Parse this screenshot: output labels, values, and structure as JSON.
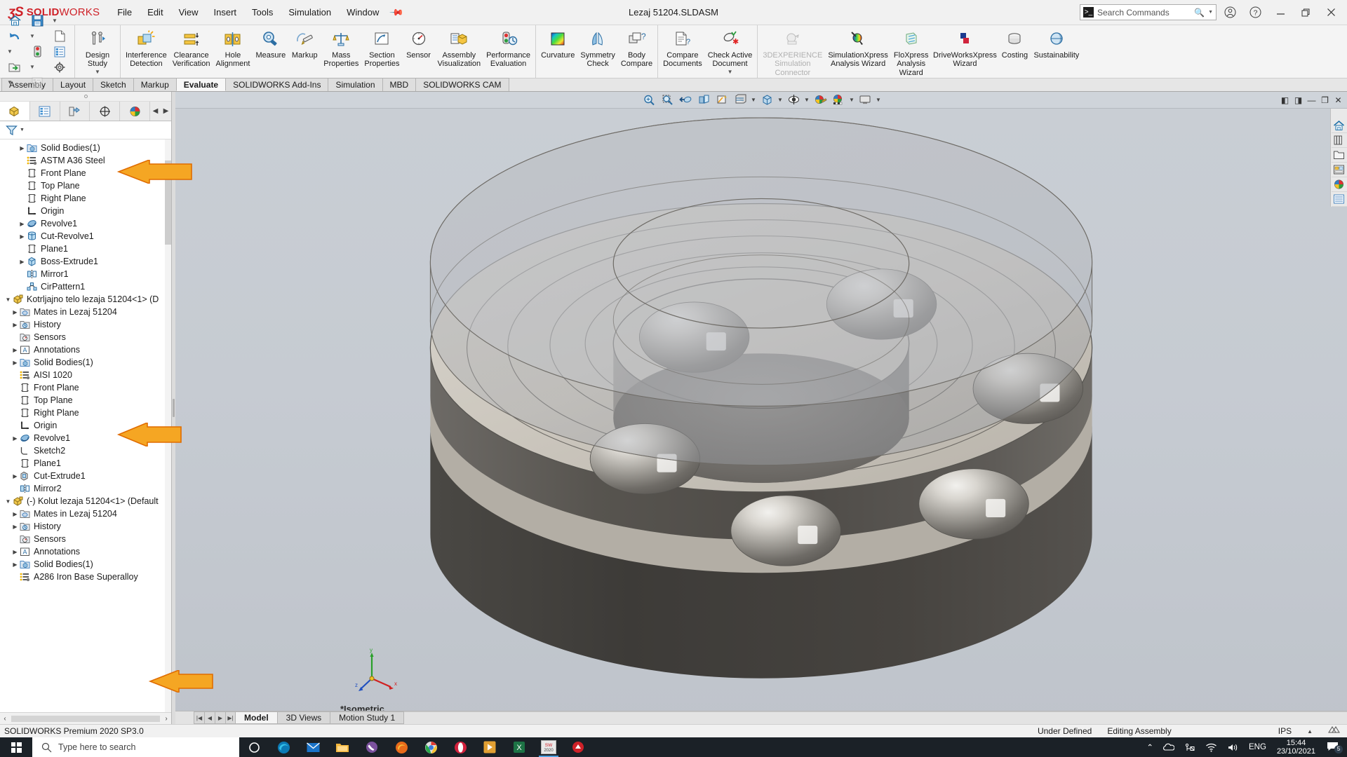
{
  "titlebar": {
    "brand_ds": "ʒS",
    "brand_solid": "SOLID",
    "brand_works": "WORKS",
    "menus": [
      "File",
      "Edit",
      "View",
      "Insert",
      "Tools",
      "Simulation",
      "Window"
    ],
    "document_title": "Lezaj 51204.SLDASM",
    "search_placeholder": "Search Commands",
    "account_icon": "user-icon",
    "help_icon": "help-icon",
    "minimize_icon": "minimize-icon",
    "restore_icon": "restore-icon",
    "close_icon": "close-icon"
  },
  "quick_access": [
    {
      "name": "home-button",
      "glyph": "⌂"
    },
    {
      "name": "save-button",
      "glyph": "💾"
    },
    {
      "name": "undo-button",
      "glyph": "↶"
    },
    {
      "name": "new-document-button",
      "glyph": "🗎"
    },
    {
      "name": "rebuild-button",
      "glyph": "🚦"
    },
    {
      "name": "options-list-button",
      "glyph": "☰"
    },
    {
      "name": "open-button",
      "glyph": "📂"
    },
    {
      "name": "settings-button",
      "glyph": "⚙"
    },
    {
      "name": "properties-button",
      "glyph": "☷"
    }
  ],
  "ribbon": {
    "groups": [
      {
        "buttons": [
          {
            "label": "Design\nStudy",
            "name": "design-study-button",
            "icon": "design-study-icon",
            "dropdown": true
          }
        ]
      },
      {
        "buttons": [
          {
            "label": "Interference\nDetection",
            "name": "interference-detection-button",
            "icon": "interference-detection-icon"
          },
          {
            "label": "Clearance\nVerification",
            "name": "clearance-verification-button",
            "icon": "clearance-verification-icon"
          },
          {
            "label": "Hole\nAlignment",
            "name": "hole-alignment-button",
            "icon": "hole-alignment-icon"
          },
          {
            "label": "Measure",
            "name": "measure-button",
            "icon": "measure-icon"
          },
          {
            "label": "Markup",
            "name": "markup-button",
            "icon": "markup-icon"
          },
          {
            "label": "Mass\nProperties",
            "name": "mass-properties-button",
            "icon": "mass-properties-icon"
          },
          {
            "label": "Section\nProperties",
            "name": "section-properties-button",
            "icon": "section-properties-icon"
          },
          {
            "label": "Sensor",
            "name": "sensor-button",
            "icon": "sensor-icon"
          },
          {
            "label": "Assembly\nVisualization",
            "name": "assembly-visualization-button",
            "icon": "assembly-visualization-icon"
          },
          {
            "label": "Performance\nEvaluation",
            "name": "performance-evaluation-button",
            "icon": "performance-evaluation-icon"
          }
        ]
      },
      {
        "buttons": [
          {
            "label": "Curvature",
            "name": "curvature-button",
            "icon": "curvature-icon"
          },
          {
            "label": "Symmetry\nCheck",
            "name": "symmetry-check-button",
            "icon": "symmetry-check-icon"
          },
          {
            "label": "Body\nCompare",
            "name": "body-compare-button",
            "icon": "body-compare-icon"
          }
        ]
      },
      {
        "buttons": [
          {
            "label": "Compare\nDocuments",
            "name": "compare-documents-button",
            "icon": "compare-documents-icon"
          },
          {
            "label": "Check Active\nDocument",
            "name": "check-active-document-button",
            "icon": "check-active-document-icon",
            "dropdown": true
          }
        ]
      },
      {
        "buttons": [
          {
            "label": "3DEXPERIENCE\nSimulation\nConnector",
            "name": "3dexperience-simulation-connector-button",
            "icon": "3dexperience-icon",
            "disabled": true
          },
          {
            "label": "SimulationXpress\nAnalysis Wizard",
            "name": "simulationxpress-analysis-wizard-button",
            "icon": "simulationxpress-icon"
          },
          {
            "label": "FloXpress\nAnalysis\nWizard",
            "name": "floxpress-analysis-wizard-button",
            "icon": "floxpress-icon"
          },
          {
            "label": "DriveWorksXpress\nWizard",
            "name": "driveworksxpress-wizard-button",
            "icon": "driveworksxpress-icon"
          },
          {
            "label": "Costing",
            "name": "costing-button",
            "icon": "costing-icon"
          },
          {
            "label": "Sustainability",
            "name": "sustainability-button",
            "icon": "sustainability-icon"
          }
        ]
      }
    ]
  },
  "ribbon_tabs": [
    {
      "label": "Assembly",
      "active": false
    },
    {
      "label": "Layout",
      "active": false
    },
    {
      "label": "Sketch",
      "active": false
    },
    {
      "label": "Markup",
      "active": false
    },
    {
      "label": "Evaluate",
      "active": true
    },
    {
      "label": "SOLIDWORKS Add-Ins",
      "active": false
    },
    {
      "label": "Simulation",
      "active": false
    },
    {
      "label": "MBD",
      "active": false
    },
    {
      "label": "SOLIDWORKS CAM",
      "active": false
    }
  ],
  "feature_manager": {
    "tabs": [
      {
        "name": "feature-manager-tab",
        "icon": "feature-tree-icon",
        "active": true
      },
      {
        "name": "property-manager-tab",
        "icon": "property-list-icon",
        "active": false
      },
      {
        "name": "configuration-manager-tab",
        "icon": "configuration-icon",
        "active": false
      },
      {
        "name": "dimxpert-manager-tab",
        "icon": "dimxpert-icon",
        "active": false
      },
      {
        "name": "display-manager-tab",
        "icon": "display-palette-icon",
        "active": false
      }
    ],
    "filter_icon": "filter-icon",
    "tree": [
      {
        "label": "Solid Bodies(1)",
        "indent": 2,
        "expand": "collapsed",
        "icon": "solid-bodies-icon"
      },
      {
        "label": "ASTM A36 Steel",
        "indent": 2,
        "expand": "none",
        "icon": "material-icon",
        "annotated": true
      },
      {
        "label": "Front Plane",
        "indent": 2,
        "expand": "none",
        "icon": "plane-icon"
      },
      {
        "label": "Top Plane",
        "indent": 2,
        "expand": "none",
        "icon": "plane-icon"
      },
      {
        "label": "Right Plane",
        "indent": 2,
        "expand": "none",
        "icon": "plane-icon"
      },
      {
        "label": "Origin",
        "indent": 2,
        "expand": "none",
        "icon": "origin-icon"
      },
      {
        "label": "Revolve1",
        "indent": 2,
        "expand": "collapsed",
        "icon": "revolve-icon"
      },
      {
        "label": "Cut-Revolve1",
        "indent": 2,
        "expand": "collapsed",
        "icon": "cut-revolve-icon"
      },
      {
        "label": "Plane1",
        "indent": 2,
        "expand": "none",
        "icon": "plane-icon"
      },
      {
        "label": "Boss-Extrude1",
        "indent": 2,
        "expand": "collapsed",
        "icon": "boss-extrude-icon"
      },
      {
        "label": "Mirror1",
        "indent": 2,
        "expand": "none",
        "icon": "mirror-icon"
      },
      {
        "label": "CirPattern1",
        "indent": 2,
        "expand": "none",
        "icon": "circular-pattern-icon"
      },
      {
        "label": "Kotrljajno telo lezaja 51204<1> (D",
        "indent": 0,
        "expand": "expanded",
        "icon": "component-icon"
      },
      {
        "label": "Mates in Lezaj 51204",
        "indent": 1,
        "expand": "collapsed",
        "icon": "mates-folder-icon"
      },
      {
        "label": "History",
        "indent": 1,
        "expand": "collapsed",
        "icon": "history-icon"
      },
      {
        "label": "Sensors",
        "indent": 1,
        "expand": "none",
        "icon": "sensors-icon"
      },
      {
        "label": "Annotations",
        "indent": 1,
        "expand": "collapsed",
        "icon": "annotations-icon"
      },
      {
        "label": "Solid Bodies(1)",
        "indent": 1,
        "expand": "collapsed",
        "icon": "solid-bodies-icon"
      },
      {
        "label": "AISI 1020",
        "indent": 1,
        "expand": "none",
        "icon": "material-icon",
        "annotated": true
      },
      {
        "label": "Front Plane",
        "indent": 1,
        "expand": "none",
        "icon": "plane-icon"
      },
      {
        "label": "Top Plane",
        "indent": 1,
        "expand": "none",
        "icon": "plane-icon"
      },
      {
        "label": "Right Plane",
        "indent": 1,
        "expand": "none",
        "icon": "plane-icon"
      },
      {
        "label": "Origin",
        "indent": 1,
        "expand": "none",
        "icon": "origin-icon"
      },
      {
        "label": "Revolve1",
        "indent": 1,
        "expand": "collapsed",
        "icon": "revolve-icon"
      },
      {
        "label": "Sketch2",
        "indent": 1,
        "expand": "none",
        "icon": "sketch-icon"
      },
      {
        "label": "Plane1",
        "indent": 1,
        "expand": "none",
        "icon": "plane-icon"
      },
      {
        "label": "Cut-Extrude1",
        "indent": 1,
        "expand": "collapsed",
        "icon": "cut-extrude-icon"
      },
      {
        "label": "Mirror2",
        "indent": 1,
        "expand": "none",
        "icon": "mirror-icon"
      },
      {
        "label": "(-) Kolut lezaja 51204<1> (Default",
        "indent": 0,
        "expand": "expanded",
        "icon": "component-icon"
      },
      {
        "label": "Mates in Lezaj 51204",
        "indent": 1,
        "expand": "collapsed",
        "icon": "mates-folder-icon"
      },
      {
        "label": "History",
        "indent": 1,
        "expand": "collapsed",
        "icon": "history-icon"
      },
      {
        "label": "Sensors",
        "indent": 1,
        "expand": "none",
        "icon": "sensors-icon"
      },
      {
        "label": "Annotations",
        "indent": 1,
        "expand": "collapsed",
        "icon": "annotations-icon"
      },
      {
        "label": "Solid Bodies(1)",
        "indent": 1,
        "expand": "collapsed",
        "icon": "solid-bodies-icon"
      },
      {
        "label": "A286 Iron Base Superalloy",
        "indent": 1,
        "expand": "none",
        "icon": "material-icon",
        "annotated": true
      }
    ]
  },
  "view_toolbar": [
    {
      "name": "zoom-to-fit-button",
      "icon": "zoom-to-fit-icon"
    },
    {
      "name": "zoom-to-area-button",
      "icon": "zoom-to-area-icon"
    },
    {
      "name": "previous-view-button",
      "icon": "previous-view-icon"
    },
    {
      "name": "section-view-button",
      "icon": "section-view-icon"
    },
    {
      "name": "view-orientation-button",
      "icon": "view-orientation-icon"
    },
    {
      "name": "display-style-button",
      "icon": "display-style-icon",
      "dropdown": true
    },
    {
      "name": "hide-show-items-button",
      "icon": "hide-show-icon",
      "dropdown": true
    },
    {
      "name": "edit-appearance-button",
      "icon": "edit-appearance-icon",
      "dropdown": true
    },
    {
      "name": "apply-scene-button",
      "icon": "apply-scene-icon",
      "dropdown": true
    },
    {
      "name": "view-settings-button",
      "icon": "view-settings-icon",
      "dropdown": true
    }
  ],
  "right_toolbar": [
    {
      "name": "sw-resources-button",
      "icon": "home-icon"
    },
    {
      "name": "design-library-button",
      "icon": "library-icon"
    },
    {
      "name": "file-explorer-button",
      "icon": "folder-icon"
    },
    {
      "name": "view-palette-button",
      "icon": "view-palette-icon"
    },
    {
      "name": "appearances-scenes-button",
      "icon": "appearances-icon"
    },
    {
      "name": "custom-properties-button",
      "icon": "custom-properties-icon"
    }
  ],
  "viewport": {
    "view_name": "*Isometric",
    "triad_labels": {
      "x": "x",
      "y": "y",
      "z": "z"
    },
    "window_controls": [
      "restore-down-icon",
      "tile-icon",
      "minimize-icon",
      "maximize-icon",
      "close-icon"
    ]
  },
  "document_tabs": [
    {
      "label": "Model",
      "active": true
    },
    {
      "label": "3D Views",
      "active": false
    },
    {
      "label": "Motion Study 1",
      "active": false
    }
  ],
  "statusbar": {
    "version": "SOLIDWORKS Premium 2020 SP3.0",
    "state": "Under Defined",
    "mode": "Editing Assembly",
    "units": "IPS"
  },
  "taskbar": {
    "search_placeholder": "Type here to search",
    "apps": [
      {
        "name": "cortana-icon"
      },
      {
        "name": "edge-icon"
      },
      {
        "name": "mail-icon"
      },
      {
        "name": "file-explorer-icon"
      },
      {
        "name": "viber-icon"
      },
      {
        "name": "firefox-icon"
      },
      {
        "name": "chrome-icon"
      },
      {
        "name": "opera-icon"
      },
      {
        "name": "media-player-icon"
      },
      {
        "name": "excel-icon"
      },
      {
        "name": "solidworks-icon"
      },
      {
        "name": "edrawings-icon"
      }
    ],
    "tray": {
      "expand_icon": "chevron-up-icon",
      "onedrive_icon": "onedrive-icon",
      "usb_icon": "usb-icon",
      "network_icon": "wifi-icon",
      "volume_icon": "volume-icon",
      "language": "ENG",
      "time": "15:44",
      "date": "23/10/2021",
      "notification_count": "5"
    }
  },
  "colors": {
    "accent_red": "#cf2128",
    "annotation_arrow": "#f5a623",
    "annotation_arrow_stroke": "#e06c00",
    "taskbar_bg": "#1b2127"
  }
}
